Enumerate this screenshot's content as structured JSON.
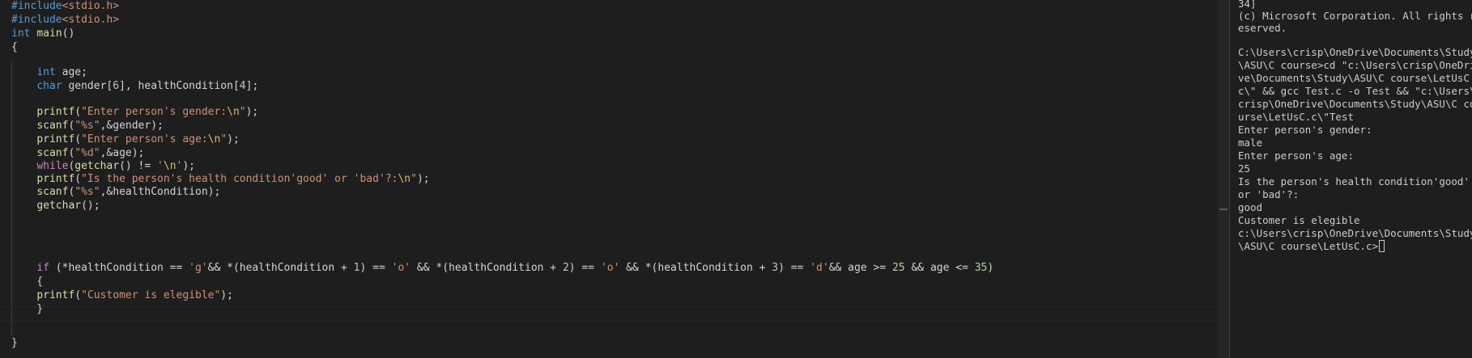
{
  "editor": {
    "language": "C",
    "lines": [
      "#include<stdio.h>",
      "#include<stdio.h>",
      "int main()",
      "{",
      "",
      "    int age;",
      "    char gender[6], healthCondition[4];",
      "",
      "    printf(\"Enter person's gender:\\n\");",
      "    scanf(\"%s\",&gender);",
      "    printf(\"Enter person's age:\\n\");",
      "    scanf(\"%d\",&age);",
      "    while(getchar() != '\\n');",
      "    printf(\"Is the person's health condition'good' or 'bad'?:\\n\");",
      "    scanf(\"%s\",&healthCondition);",
      "    getchar();",
      "",
      "    if (*healthCondition == 'g'&& *(healthCondition + 1) == 'o' && *(healthCondition + 2) == 'o' && *(healthCondition + 3) == 'd'&& age >= 25 && age <= 35)",
      "    {",
      "    printf(\"Customer is elegible\");",
      "    }",
      "",
      "}"
    ]
  },
  "terminal": {
    "lines": [
      "34]",
      "(c) Microsoft Corporation. All rights r",
      "eserved.",
      "",
      "C:\\Users\\crisp\\OneDrive\\Documents\\Study",
      "\\ASU\\C course>cd \"c:\\Users\\crisp\\OneDri",
      "ve\\Documents\\Study\\ASU\\C course\\LetUsC.",
      "c\\\" && gcc Test.c -o Test && \"c:\\Users\\",
      "crisp\\OneDrive\\Documents\\Study\\ASU\\C co",
      "urse\\LetUsC.c\\\"Test",
      "Enter person's gender:",
      "male",
      "Enter person's age:",
      "25",
      "Is the person's health condition'good'",
      "or 'bad'?:",
      "good",
      "Customer is elegible",
      "c:\\Users\\crisp\\OneDrive\\Documents\\Study",
      "\\ASU\\C course\\LetUsC.c>"
    ]
  },
  "colors": {
    "background": "#1e1e1e",
    "keyword": "#569cd6",
    "function": "#dcdcaa",
    "string": "#ce9178",
    "number": "#b5cea8",
    "text": "#d4d4d4",
    "terminal_text": "#cccccc"
  }
}
